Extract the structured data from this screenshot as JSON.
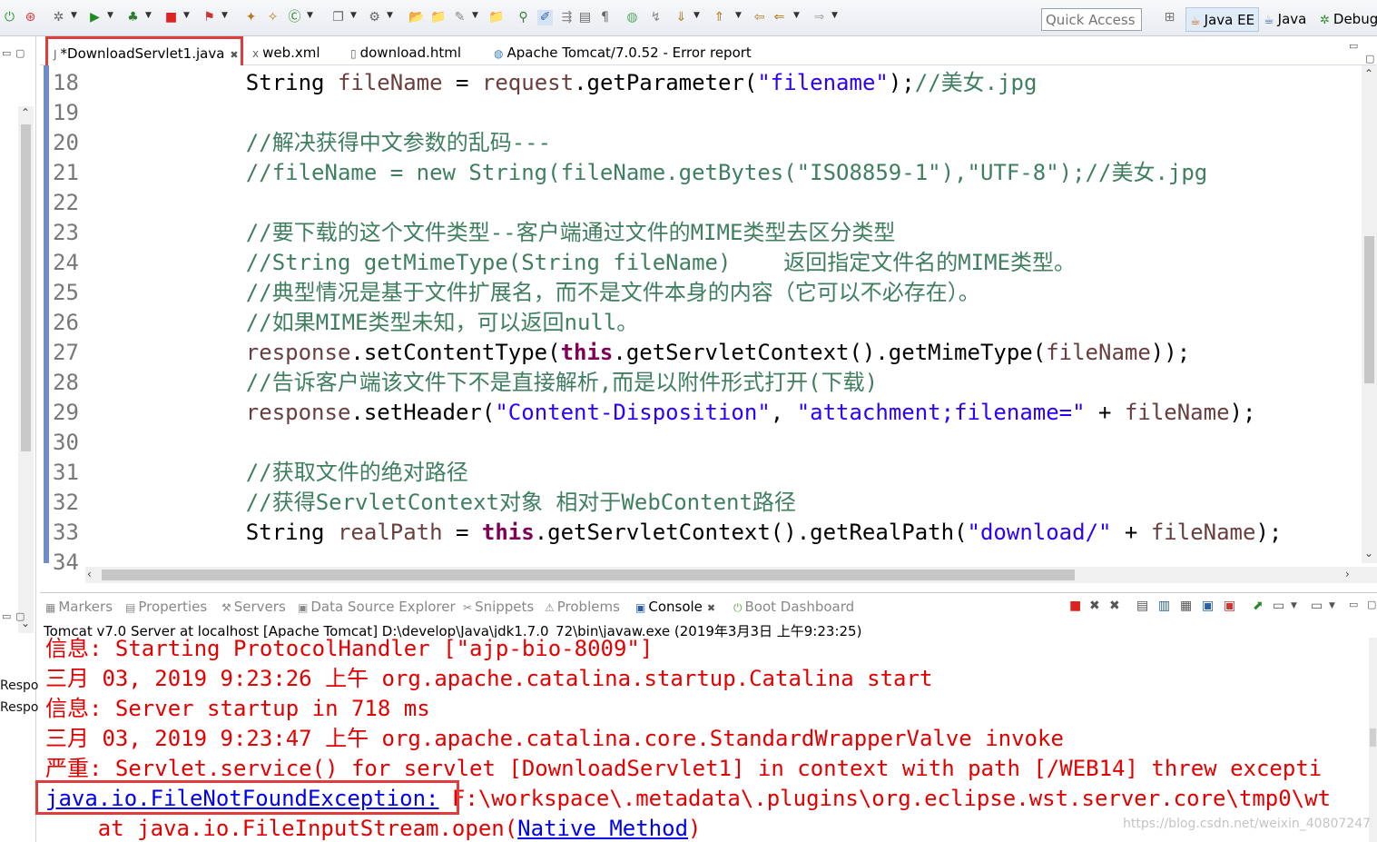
{
  "toolbar": {
    "quick_access_placeholder": "Quick Access",
    "perspectives": [
      {
        "label": "Java EE",
        "icon": "java-ee-icon"
      },
      {
        "label": "Java",
        "icon": "java-perspective-icon"
      },
      {
        "label": "Debug",
        "icon": "debug-perspective-icon"
      }
    ]
  },
  "left_panel": {
    "fragments": [
      "Respo",
      "Respo"
    ]
  },
  "editor": {
    "tabs": [
      {
        "label": "*DownloadServlet1.java",
        "icon": "java-file-icon"
      },
      {
        "label": "web.xml",
        "icon": "xml-file-icon"
      },
      {
        "label": "download.html",
        "icon": "html-file-icon"
      },
      {
        "label": "Apache Tomcat/7.0.52 - Error report",
        "icon": "globe-icon"
      }
    ],
    "lines": [
      {
        "num": "18",
        "text": "String fileName = request.getParameter(\"filename\");//美女.jpg"
      },
      {
        "num": "19",
        "text": ""
      },
      {
        "num": "20",
        "text": "//解决获得中文参数的乱码---"
      },
      {
        "num": "21",
        "text": "//fileName = new String(fileName.getBytes(\"ISO8859-1\"),\"UTF-8\");//美女.jpg"
      },
      {
        "num": "22",
        "text": ""
      },
      {
        "num": "23",
        "text": "//要下载的这个文件类型--客户端通过文件的MIME类型去区分类型"
      },
      {
        "num": "24",
        "text": "//String getMimeType(String fileName)    返回指定文件名的MIME类型。"
      },
      {
        "num": "25",
        "text": "//典型情况是基于文件扩展名，而不是文件本身的内容（它可以不必存在）。"
      },
      {
        "num": "26",
        "text": "//如果MIME类型未知，可以返回null。"
      },
      {
        "num": "27",
        "text": "response.setContentType(this.getServletContext().getMimeType(fileName));"
      },
      {
        "num": "28",
        "text": "//告诉客户端该文件下不是直接解析,而是以附件形式打开(下载)"
      },
      {
        "num": "29",
        "text": "response.setHeader(\"Content-Disposition\", \"attachment;filename=\" + fileName);"
      },
      {
        "num": "30",
        "text": ""
      },
      {
        "num": "31",
        "text": "//获取文件的绝对路径"
      },
      {
        "num": "32",
        "text": "//获得ServletContext对象 相对于WebContent路径"
      },
      {
        "num": "33",
        "text": "String realPath = this.getServletContext().getRealPath(\"download/\" + fileName);"
      },
      {
        "num": "34",
        "text": ""
      }
    ]
  },
  "console": {
    "view_tabs": [
      {
        "label": "Markers",
        "icon": "markers-icon"
      },
      {
        "label": "Properties",
        "icon": "properties-icon"
      },
      {
        "label": "Servers",
        "icon": "servers-icon"
      },
      {
        "label": "Data Source Explorer",
        "icon": "data-source-icon"
      },
      {
        "label": "Snippets",
        "icon": "snippets-icon"
      },
      {
        "label": "Problems",
        "icon": "problems-icon"
      },
      {
        "label": "Console",
        "icon": "console-icon"
      },
      {
        "label": "Boot Dashboard",
        "icon": "boot-dashboard-icon"
      }
    ],
    "description": "Tomcat v7.0 Server at localhost [Apache Tomcat] D:\\develop\\Java\\jdk1.7.0_72\\bin\\javaw.exe (2019年3月3日 上午9:23:25)",
    "lines": [
      "信息: Starting ProtocolHandler [\"ajp-bio-8009\"]",
      "三月 03, 2019 9:23:26 上午 org.apache.catalina.startup.Catalina start",
      "信息: Server startup in 718 ms",
      "三月 03, 2019 9:23:47 上午 org.apache.catalina.core.StandardWrapperValve invoke",
      "严重: Servlet.service() for servlet [DownloadServlet1] in context with path [/WEB14] threw excepti"
    ],
    "exception_link": "java.io.FileNotFoundException:",
    "exception_rest": " F:\\workspace\\.metadata\\.plugins\\org.eclipse.wst.server.core\\tmp0\\wt",
    "stack_prefix": "    at java.io.FileInputStream.open(",
    "stack_link": "Native Method",
    "stack_suffix": ")"
  },
  "watermark": "https://blog.csdn.net/weixin_40807247",
  "colors": {
    "comment": "#3f7f5f",
    "keyword": "#7f0055",
    "string": "#2a00ff",
    "console_error": "#e30000",
    "highlight_box": "#e03c3c"
  }
}
